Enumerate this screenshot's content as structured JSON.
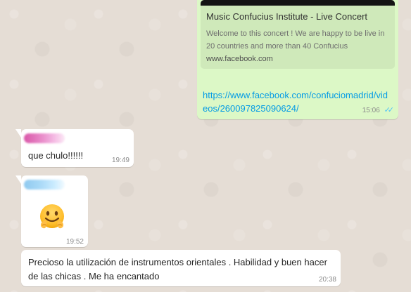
{
  "link_preview": {
    "title": "Music Confucius Institute - Live Concert",
    "description": "Welcome to this concert ! We are happy to be live in 20 countries and more than 40 Confucius",
    "domain": "www.facebook.com",
    "url": "https://www.facebook.com/confuciomadrid/videos/260097825090624/",
    "time": "15:06",
    "status_icon": "double-check-icon",
    "status_color": "#4fc3f7"
  },
  "messages": [
    {
      "sender_color": "#d84ea4",
      "text": "que chulo!!!!!!",
      "time": "19:49"
    },
    {
      "sender_color": "#8ac7ef",
      "emoji_name": "hugging-face-icon",
      "time": "19:52"
    },
    {
      "text": "Precioso la utilización de instrumentos orientales . Habilidad y buen hacer de las chicas .    Me ha encantado",
      "time": "20:38"
    }
  ],
  "colors": {
    "background": "#e5ddd5",
    "outgoing_bubble": "#dcf8c6",
    "incoming_bubble": "#ffffff",
    "link": "#039be5"
  }
}
